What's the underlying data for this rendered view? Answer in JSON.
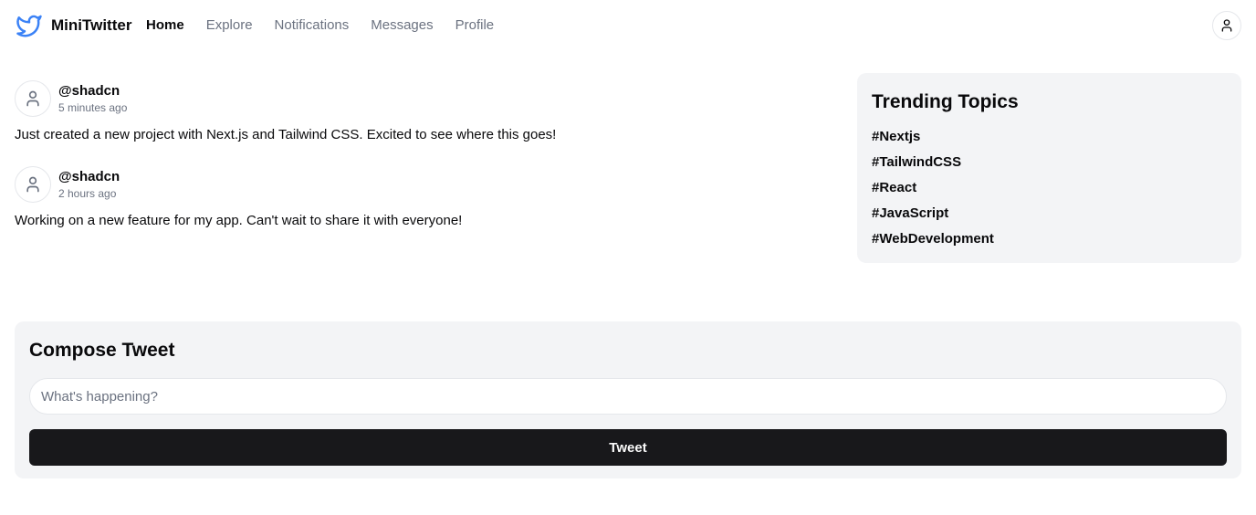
{
  "app": {
    "name": "MiniTwitter"
  },
  "nav": {
    "items": [
      {
        "label": "Home",
        "active": true
      },
      {
        "label": "Explore",
        "active": false
      },
      {
        "label": "Notifications",
        "active": false
      },
      {
        "label": "Messages",
        "active": false
      },
      {
        "label": "Profile",
        "active": false
      }
    ]
  },
  "header": {
    "profile_icon": "user-icon"
  },
  "feed": {
    "tweets": [
      {
        "handle": "@shadcn",
        "time": "5 minutes ago",
        "text": "Just created a new project with Next.js and Tailwind CSS. Excited to see where this goes!"
      },
      {
        "handle": "@shadcn",
        "time": "2 hours ago",
        "text": "Working on a new feature for my app. Can't wait to share it with everyone!"
      }
    ]
  },
  "trending": {
    "title": "Trending Topics",
    "topics": [
      "#Nextjs",
      "#TailwindCSS",
      "#React",
      "#JavaScript",
      "#WebDevelopment"
    ]
  },
  "compose": {
    "title": "Compose Tweet",
    "placeholder": "What's happening?",
    "value": "",
    "button_label": "Tweet"
  },
  "colors": {
    "brand": "#3b82f6",
    "panel": "#f3f4f6",
    "button": "#18181b",
    "muted_text": "#6b7280"
  }
}
